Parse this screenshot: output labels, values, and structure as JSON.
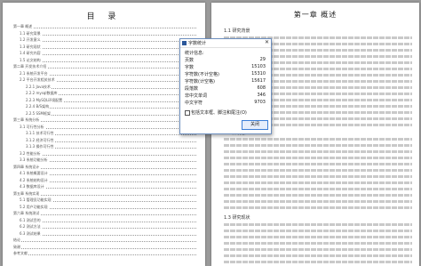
{
  "toc": {
    "title": "目 录",
    "entries": [
      "第一章 概述",
      "1.1 研究背景",
      "1.2 开发意义",
      "1.3 研究现状",
      "1.4 研究内容",
      "1.5 论文结构",
      "第二章 开发技术介绍",
      "2.1 系统开发平台",
      "2.2 平台开发相关技术",
      "2.2.1 Java技术",
      "2.2.2 mysql数据库",
      "2.2.3 MySQL环境配置",
      "2.2.4 B/S架构",
      "2.2.5 SSM框架",
      "第三章 系统分析",
      "3.1 可行性分析",
      "3.1.1 技术可行性",
      "3.1.2 经济可行性",
      "3.1.3 操作可行性",
      "3.2 性能分析",
      "3.3 系统功能分析",
      "第四章 系统设计",
      "4.1 系统概要设计",
      "4.2 系统结构设计",
      "4.3 数据库设计",
      "第五章 系统实现",
      "5.1 管理员功能实现",
      "5.2 用户功能实现",
      "第六章 系统测试",
      "6.1 测试目的",
      "6.2 测试方法",
      "6.3 测试结果",
      "结论",
      "致谢",
      "参考文献"
    ]
  },
  "document": {
    "chapter_title": "第一章 概述",
    "sections": [
      "1.1 研究背景",
      "1.2 开发意义",
      "1.3 研究现状"
    ]
  },
  "dialog": {
    "title": "字数统计",
    "close_glyph": "✕",
    "group_label": "统计信息:",
    "stats": [
      {
        "label": "页数",
        "value": "29"
      },
      {
        "label": "字数",
        "value": "15103"
      },
      {
        "label": "字符数(不计空格)",
        "value": "15310"
      },
      {
        "label": "字符数(计空格)",
        "value": "15617"
      },
      {
        "label": "段落数",
        "value": "608"
      },
      {
        "label": "非中文单词",
        "value": "346"
      },
      {
        "label": "中文字符",
        "value": "9703"
      }
    ],
    "checkbox_label": "包括文本框、脚注和尾注(O)",
    "checkbox_checked": false,
    "close_button": "关闭"
  }
}
